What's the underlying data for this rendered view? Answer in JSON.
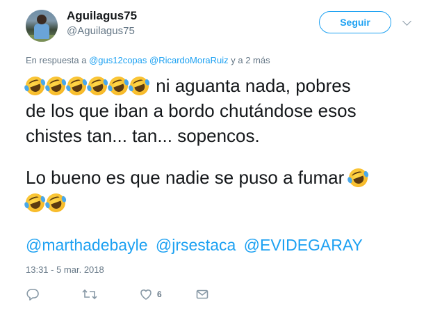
{
  "user": {
    "name": "Aguilagus75",
    "handle": "@Aguilagus75"
  },
  "follow_button": {
    "label": "Seguir"
  },
  "reply_to": {
    "prefix": "En respuesta a",
    "mention_1": "@gus12copas",
    "mention_2": "@RicardoMoraRuiz",
    "suffix": "y a 2 más"
  },
  "tweet": {
    "line_1": "ni aguanta nada, pobres",
    "line_2": "de los que iban a bordo chutándose esos",
    "line_3": "chistes tan... tan... sopencos.",
    "line_4": "Lo bueno es que nadie se puso a fumar",
    "emoji_name": "rolling-on-floor-laughing"
  },
  "mentions": [
    "@marthadebayle",
    "@jrsestaca",
    "@EVIDEGARAY"
  ],
  "timestamp": "13:31 - 5 mar. 2018",
  "actions": {
    "like_count": "6"
  },
  "colors": {
    "accent": "#1da1f2",
    "muted": "#657786",
    "text": "#14171a",
    "icon": "#8899a6"
  }
}
